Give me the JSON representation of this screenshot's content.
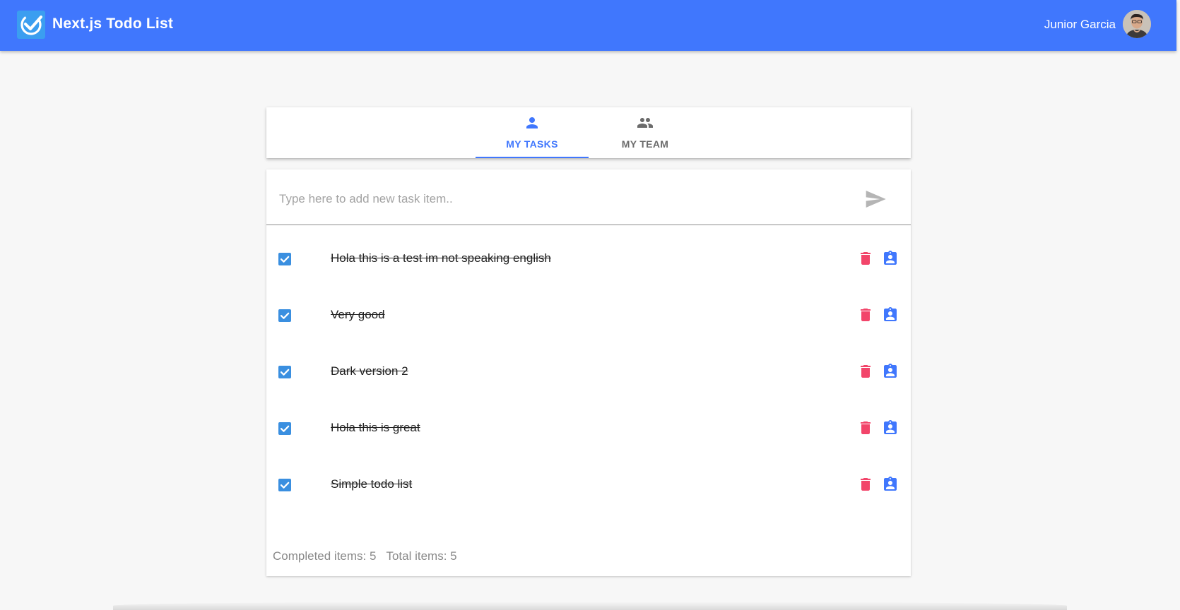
{
  "app": {
    "title": "Next.js Todo List",
    "user_name": "Junior Garcia",
    "accent_color": "#4077fd"
  },
  "tabs": [
    {
      "label": "MY TASKS",
      "icon": "person-icon",
      "active": true
    },
    {
      "label": "MY TEAM",
      "icon": "group-icon",
      "active": false
    }
  ],
  "new_task": {
    "placeholder": "Type here to add new task item..",
    "value": "",
    "send_icon": "send-icon"
  },
  "tasks": [
    {
      "text": "Hola this is a test im not speaking english",
      "completed": true
    },
    {
      "text": "Very good",
      "completed": true
    },
    {
      "text": "Dark version 2",
      "completed": true
    },
    {
      "text": "Hola this is great",
      "completed": true
    },
    {
      "text": "Simple todo list",
      "completed": true
    }
  ],
  "task_actions": {
    "delete_icon": "trash-icon",
    "assign_icon": "assignment-ind-icon",
    "delete_color": "#f2456a",
    "assign_color": "#4077fd"
  },
  "footer": {
    "completed_label": "Completed items: 5",
    "total_label": "Total items: 5"
  }
}
